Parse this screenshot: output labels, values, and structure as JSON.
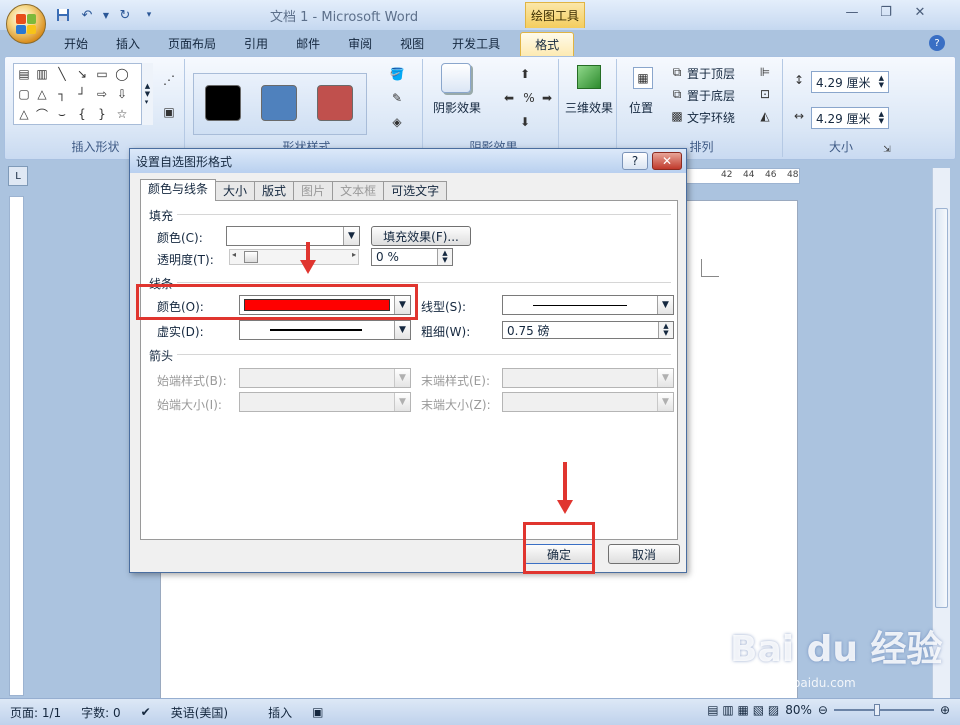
{
  "window": {
    "title": "文档 1 - Microsoft Word",
    "tool_context": "绘图工具"
  },
  "ribbon": {
    "tabs": [
      "开始",
      "插入",
      "页面布局",
      "引用",
      "邮件",
      "审阅",
      "视图",
      "开发工具",
      "格式"
    ],
    "active_tab": "格式",
    "groups": {
      "insert_shapes": "插入形状",
      "shape_styles": "形状样式",
      "shadow": "阴影效果",
      "shadow_btn": "阴影效果",
      "three_d": "三维效果",
      "arrange": "排列",
      "position_btn": "位置",
      "bring_front": "置于顶层",
      "send_back": "置于底层",
      "text_wrap": "文字环绕",
      "size": "大小"
    },
    "style_swatches": [
      "#000000",
      "#4f81bd",
      "#c0504d"
    ],
    "height_value": "4.29 厘米",
    "width_value": "4.29 厘米"
  },
  "ruler": {
    "h_ticks": [
      "42",
      "44",
      "46",
      "48"
    ]
  },
  "dialog": {
    "title": "设置自选图形格式",
    "tabs": [
      {
        "label": "颜色与线条",
        "state": "active"
      },
      {
        "label": "大小",
        "state": "normal"
      },
      {
        "label": "版式",
        "state": "normal"
      },
      {
        "label": "图片",
        "state": "disabled"
      },
      {
        "label": "文本框",
        "state": "disabled"
      },
      {
        "label": "可选文字",
        "state": "normal"
      }
    ],
    "fill": {
      "section": "填充",
      "color_label": "颜色(C):",
      "effects_button": "填充效果(F)...",
      "transparency_label": "透明度(T):",
      "transparency_value": "0 %"
    },
    "line": {
      "section": "线条",
      "color_label": "颜色(O):",
      "color_value": "#ff0000",
      "style_label": "线型(S):",
      "dash_label": "虚实(D):",
      "weight_label": "粗细(W):",
      "weight_value": "0.75 磅"
    },
    "arrows": {
      "section": "箭头",
      "begin_style": "始端样式(B):",
      "end_style": "末端样式(E):",
      "begin_size": "始端大小(I):",
      "end_size": "末端大小(Z):"
    },
    "ok": "确定",
    "cancel": "取消",
    "help_icon": "question-icon",
    "close_icon": "close-icon"
  },
  "status": {
    "page": "页面: 1/1",
    "words": "字数: 0",
    "language": "英语(美国)",
    "mode": "插入",
    "zoom": "80%"
  },
  "watermark": {
    "brand": "Bai du 经验",
    "url": "jingyan.baidu.com"
  },
  "annotation_color": "#e0352f"
}
